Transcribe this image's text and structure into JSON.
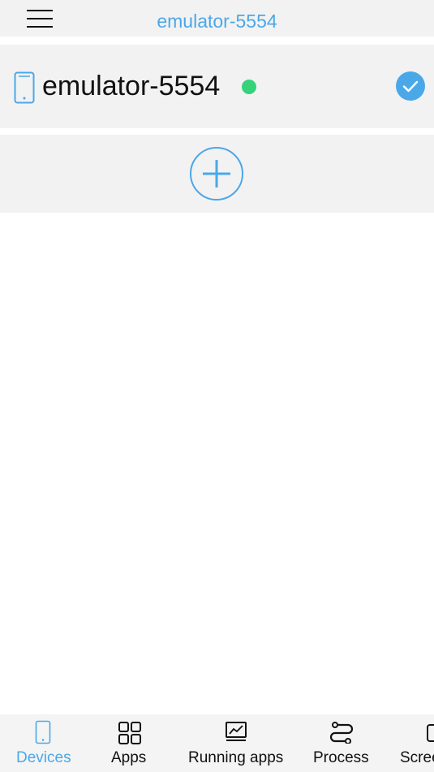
{
  "header": {
    "title": "emulator-5554",
    "menu_icon": "hamburger-menu-icon"
  },
  "device": {
    "name": "emulator-5554",
    "icon": "phone-icon",
    "status": "online",
    "status_color": "#36d27a",
    "selected": true
  },
  "add_device": {
    "icon": "plus-circle-icon"
  },
  "bottom_nav": {
    "items": [
      {
        "label": "Devices",
        "icon": "phone-icon",
        "active": true
      },
      {
        "label": "Apps",
        "icon": "grid-icon",
        "active": false
      },
      {
        "label": "Running apps",
        "icon": "chart-icon",
        "active": false
      },
      {
        "label": "Process",
        "icon": "process-icon",
        "active": false
      },
      {
        "label": "Screen",
        "icon": "screen-icon",
        "active": false
      }
    ]
  },
  "colors": {
    "accent": "#4aa8e8",
    "panel_bg": "#f2f2f2",
    "nav_bg": "#f4f4f4"
  }
}
